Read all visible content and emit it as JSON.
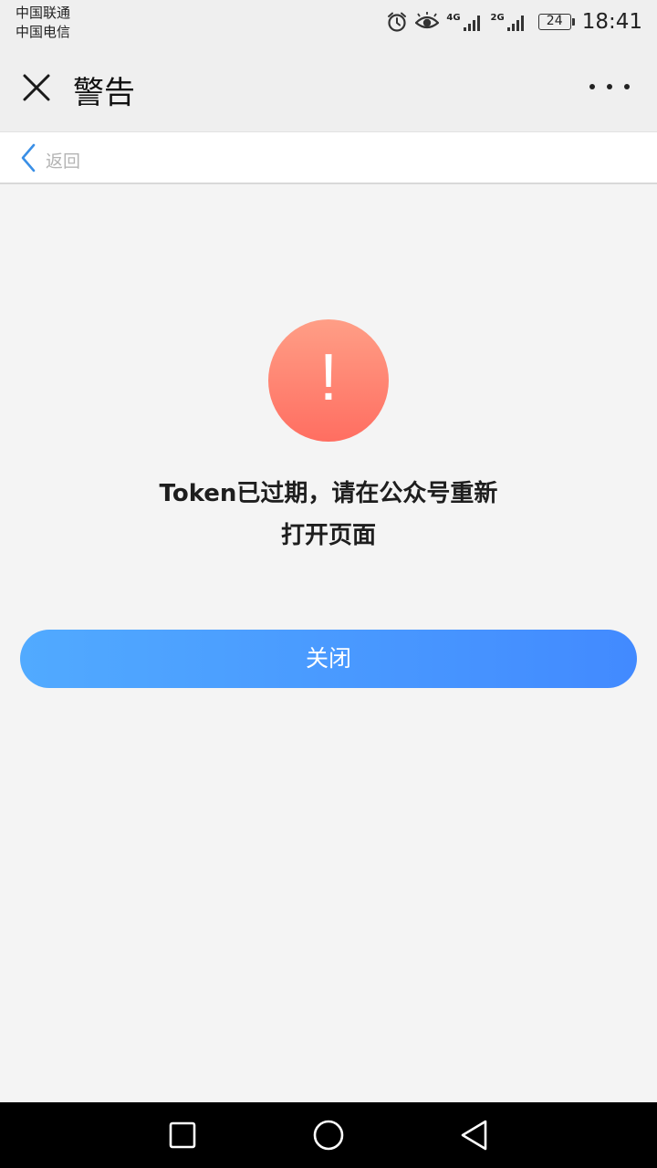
{
  "status_bar": {
    "carrier_1": "中国联通",
    "carrier_2": "中国电信",
    "network_1": "4G",
    "network_2": "2G",
    "battery": "24",
    "time": "18:41",
    "icons": [
      "alarm-icon",
      "eye-icon",
      "signal-icon",
      "signal-icon",
      "battery-icon"
    ]
  },
  "header": {
    "title": "警告",
    "close_icon": "close-icon",
    "more_icon": "more-dots-icon"
  },
  "back_bar": {
    "back_label": "返回",
    "back_icon": "chevron-left-icon"
  },
  "alert": {
    "icon_symbol": "!",
    "message_line_1": "Token已过期，请在公众号重新",
    "message_line_2": "打开页面"
  },
  "primary_button": {
    "label": "关闭"
  },
  "system_nav": {
    "icons": [
      "recent-apps-icon",
      "home-icon",
      "back-triangle-icon"
    ]
  },
  "colors": {
    "accent_blue": "#428aff",
    "warning_red": "#ff6e61",
    "background": "#f4f4f4"
  }
}
